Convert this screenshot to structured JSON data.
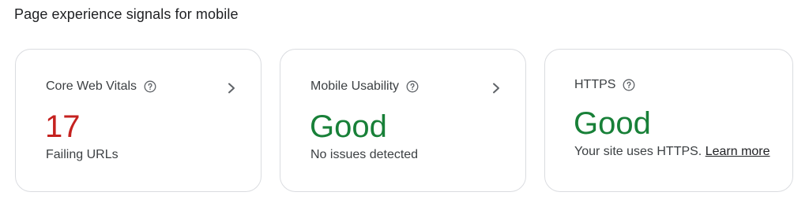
{
  "section_title": "Page experience signals for mobile",
  "colors": {
    "failing": "#c5221f",
    "good": "#188038",
    "border": "#dadce0"
  },
  "cards": [
    {
      "title": "Core Web Vitals",
      "help_icon": "help-circle-icon",
      "chevron_icon": "chevron-right-icon",
      "value": "17",
      "value_status": "failing",
      "subtitle": "Failing URLs"
    },
    {
      "title": "Mobile Usability",
      "help_icon": "help-circle-icon",
      "chevron_icon": "chevron-right-icon",
      "value": "Good",
      "value_status": "good",
      "subtitle": "No issues detected"
    },
    {
      "title": "HTTPS",
      "help_icon": "help-circle-icon",
      "value": "Good",
      "value_status": "good",
      "subtitle": "Your site uses HTTPS.",
      "link_label": "Learn more"
    }
  ]
}
